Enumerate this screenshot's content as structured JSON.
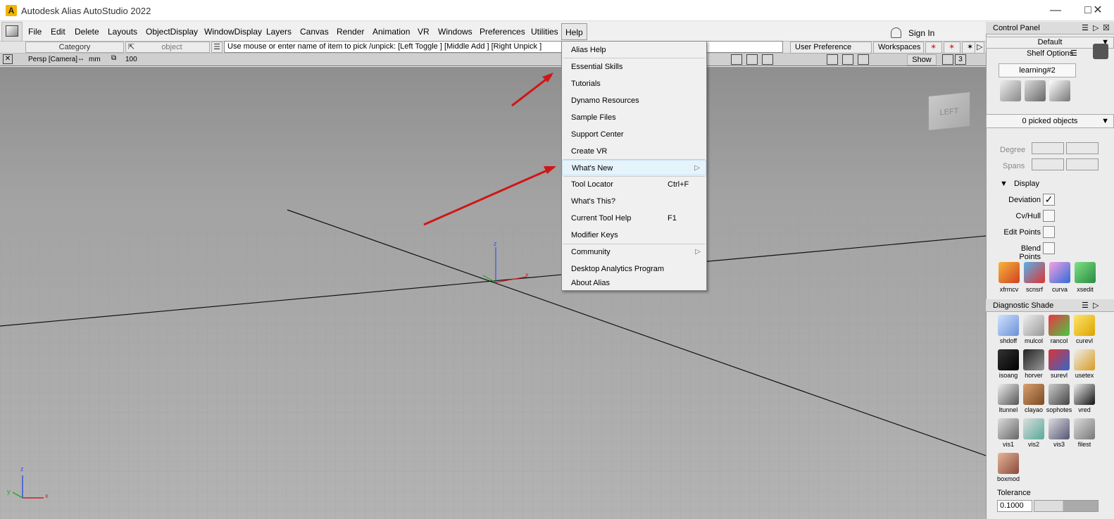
{
  "window": {
    "title": "Autodesk Alias AutoStudio 2022",
    "logo": "A"
  },
  "menubar": {
    "items": [
      "File",
      "Edit",
      "Delete",
      "Layouts",
      "ObjectDisplay",
      "WindowDisplay",
      "Layers",
      "Canvas",
      "Render",
      "Animation",
      "VR",
      "Windows",
      "Preferences",
      "Utilities",
      "Help"
    ],
    "active": "Help",
    "sign_in": "Sign In"
  },
  "toolbar": {
    "object_label": "object",
    "category": "Category",
    "object_field": "object",
    "prompt": "Use mouse or enter name of item to pick /unpick: [Left Toggle ] [Middle Add ] [Right Unpick ]",
    "user_pref_sets": "User Preference Sets",
    "workspaces": "Workspaces"
  },
  "viewport": {
    "camera": "Persp [Camera]",
    "units": "mm",
    "grid": "100",
    "show_button": "Show",
    "quality": "3",
    "viewcube_label": "LEFT",
    "axis_z": "z",
    "axis_y": "y",
    "axis_x": "x"
  },
  "help_menu": {
    "items": [
      {
        "label": "Alias Help",
        "shortcut": "",
        "submenu": false
      },
      {
        "label": "Essential Skills",
        "shortcut": "",
        "submenu": false
      },
      {
        "label": "Tutorials",
        "shortcut": "",
        "submenu": false
      },
      {
        "label": "Dynamo Resources",
        "shortcut": "",
        "submenu": false
      },
      {
        "label": "Sample Files",
        "shortcut": "",
        "submenu": false
      },
      {
        "label": "Support Center",
        "shortcut": "",
        "submenu": false
      },
      {
        "label": "Create VR",
        "shortcut": "",
        "submenu": false
      },
      {
        "label": "What's New",
        "shortcut": "",
        "submenu": true
      },
      {
        "label": "Tool Locator",
        "shortcut": "Ctrl+F",
        "submenu": false
      },
      {
        "label": "What's This?",
        "shortcut": "",
        "submenu": false
      },
      {
        "label": "Current Tool Help",
        "shortcut": "F1",
        "submenu": false
      },
      {
        "label": "Modifier Keys",
        "shortcut": "",
        "submenu": false
      },
      {
        "label": "Community",
        "shortcut": "",
        "submenu": true
      },
      {
        "label": "Desktop Analytics Program",
        "shortcut": "",
        "submenu": false
      },
      {
        "label": "About Alias",
        "shortcut": "",
        "submenu": false
      }
    ]
  },
  "control_panel": {
    "title": "Control Panel",
    "preset": "Default",
    "shelf_options": "Shelf Options",
    "shelf_tab": "learning#2",
    "picked": "0 picked objects",
    "degree_label": "Degree",
    "spans_label": "Spans",
    "display_section": "Display",
    "display_options": [
      {
        "label": "Deviation",
        "checked": true
      },
      {
        "label": "Cv/Hull",
        "checked": false
      },
      {
        "label": "Edit Points",
        "checked": false
      },
      {
        "label": "Blend Points",
        "checked": false
      }
    ],
    "shelf_tools": [
      "xfrmcv",
      "scnsrf",
      "curva",
      "xsedit"
    ],
    "diagnostic_title": "Diagnostic Shade",
    "diagnostic_tools": [
      "shdoff",
      "mulcol",
      "rancol",
      "curevl",
      "isoang",
      "horver",
      "surevl",
      "usetex",
      "ltunnel",
      "clayao",
      "sophotes",
      "vred",
      "vis1",
      "vis2",
      "vis3",
      "filest",
      "boxmod"
    ],
    "tolerance_label": "Tolerance",
    "tolerance_value": "0.1000"
  }
}
